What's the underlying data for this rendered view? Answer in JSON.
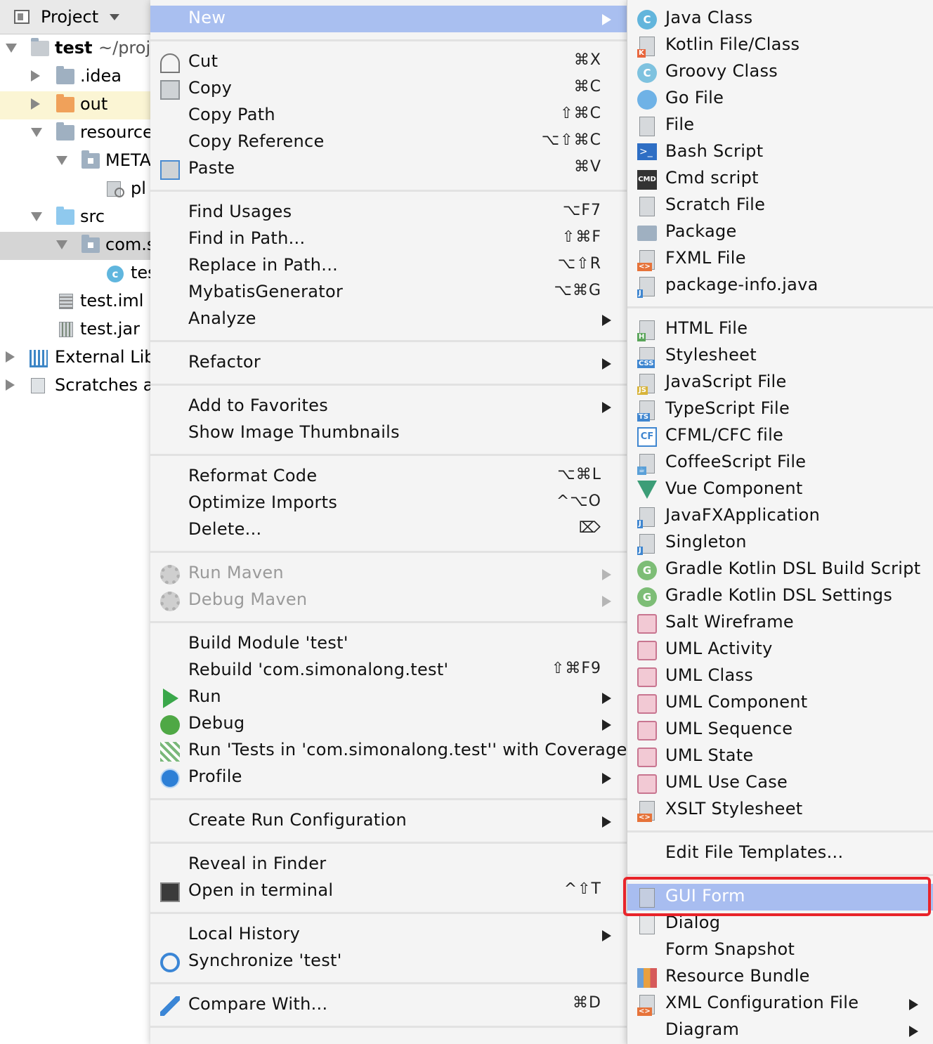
{
  "project": {
    "title": "Project",
    "tree": [
      {
        "label": "test",
        "suffix": "~/proj"
      },
      {
        "label": ".idea"
      },
      {
        "label": "out"
      },
      {
        "label": "resource"
      },
      {
        "label": "META"
      },
      {
        "label": "pl"
      },
      {
        "label": "src"
      },
      {
        "label": "com.s"
      },
      {
        "label": "tes"
      },
      {
        "label": "test.iml"
      },
      {
        "label": "test.jar"
      },
      {
        "label": "External Lib"
      },
      {
        "label": "Scratches ar"
      }
    ]
  },
  "context_menu": {
    "items": [
      {
        "label": "New",
        "submenu": true,
        "selected": true
      },
      {
        "label": "Cut",
        "shortcut": "⌘X"
      },
      {
        "label": "Copy",
        "shortcut": "⌘C"
      },
      {
        "label": "Copy Path",
        "shortcut": "⇧⌘C"
      },
      {
        "label": "Copy Reference",
        "shortcut": "⌥⇧⌘C"
      },
      {
        "label": "Paste",
        "shortcut": "⌘V"
      },
      {
        "label": "Find Usages",
        "shortcut": "⌥F7"
      },
      {
        "label": "Find in Path...",
        "shortcut": "⇧⌘F"
      },
      {
        "label": "Replace in Path...",
        "shortcut": "⌥⇧R"
      },
      {
        "label": "MybatisGenerator",
        "shortcut": "⌥⌘G"
      },
      {
        "label": "Analyze",
        "submenu": true
      },
      {
        "label": "Refactor",
        "submenu": true
      },
      {
        "label": "Add to Favorites",
        "submenu": true
      },
      {
        "label": "Show Image Thumbnails"
      },
      {
        "label": "Reformat Code",
        "shortcut": "⌥⌘L"
      },
      {
        "label": "Optimize Imports",
        "shortcut": "^⌥O"
      },
      {
        "label": "Delete...",
        "shortcut": "⌦"
      },
      {
        "label": "Run Maven",
        "submenu": true,
        "disabled": true
      },
      {
        "label": "Debug Maven",
        "submenu": true,
        "disabled": true
      },
      {
        "label": "Build Module 'test'"
      },
      {
        "label": "Rebuild 'com.simonalong.test'",
        "shortcut": "⇧⌘F9"
      },
      {
        "label": "Run",
        "submenu": true
      },
      {
        "label": "Debug",
        "submenu": true
      },
      {
        "label": "Run 'Tests in 'com.simonalong.test'' with Coverage"
      },
      {
        "label": "Profile",
        "submenu": true
      },
      {
        "label": "Create Run Configuration",
        "submenu": true
      },
      {
        "label": "Reveal in Finder"
      },
      {
        "label": "Open in terminal",
        "shortcut": "^⇧T"
      },
      {
        "label": "Local History",
        "submenu": true
      },
      {
        "label": "Synchronize 'test'"
      },
      {
        "label": "Compare With...",
        "shortcut": "⌘D"
      }
    ]
  },
  "new_submenu": {
    "items": [
      {
        "label": "Java Class",
        "icon": "C"
      },
      {
        "label": "Kotlin File/Class"
      },
      {
        "label": "Groovy Class",
        "icon": "C"
      },
      {
        "label": "Go File"
      },
      {
        "label": "File"
      },
      {
        "label": "Bash Script"
      },
      {
        "label": "Cmd script",
        "icon": "CMD"
      },
      {
        "label": "Scratch File"
      },
      {
        "label": "Package"
      },
      {
        "label": "FXML File",
        "icon": "<>"
      },
      {
        "label": "package-info.java",
        "icon": "J"
      },
      {
        "label": "HTML File",
        "icon": "H"
      },
      {
        "label": "Stylesheet",
        "icon": "CSS"
      },
      {
        "label": "JavaScript File",
        "icon": "JS"
      },
      {
        "label": "TypeScript File",
        "icon": "TS"
      },
      {
        "label": "CFML/CFC file",
        "icon": "CF"
      },
      {
        "label": "CoffeeScript File"
      },
      {
        "label": "Vue Component"
      },
      {
        "label": "JavaFXApplication",
        "icon": "J"
      },
      {
        "label": "Singleton",
        "icon": "J"
      },
      {
        "label": "Gradle Kotlin DSL Build Script",
        "icon": "G"
      },
      {
        "label": "Gradle Kotlin DSL Settings",
        "icon": "G"
      },
      {
        "label": "Salt Wireframe"
      },
      {
        "label": "UML Activity"
      },
      {
        "label": "UML Class"
      },
      {
        "label": "UML Component"
      },
      {
        "label": "UML Sequence"
      },
      {
        "label": "UML State"
      },
      {
        "label": "UML Use Case"
      },
      {
        "label": "XSLT Stylesheet",
        "icon": "<>"
      },
      {
        "label": "Edit File Templates..."
      },
      {
        "label": "GUI Form",
        "highlighted": true
      },
      {
        "label": "Dialog"
      },
      {
        "label": "Form Snapshot"
      },
      {
        "label": "Resource Bundle"
      },
      {
        "label": "XML Configuration File",
        "icon": "<>",
        "submenu": true
      },
      {
        "label": "Diagram",
        "submenu": true
      }
    ]
  },
  "colors": {
    "selection": "#a9bff0",
    "highlight_box": "#e8242a",
    "tree_highlight_yellow": "#fbf5d4",
    "tree_highlight_gray": "#d5d5d5"
  }
}
